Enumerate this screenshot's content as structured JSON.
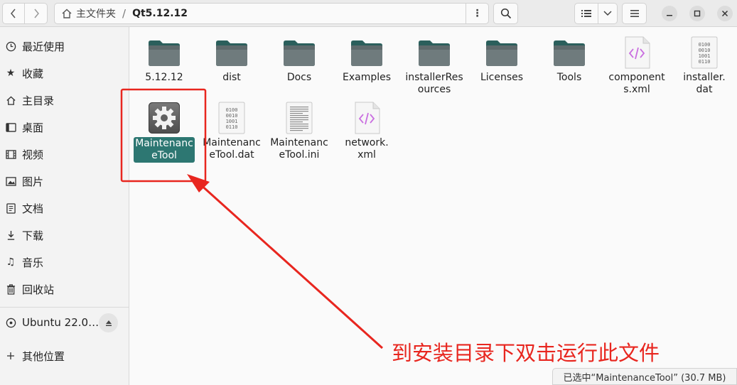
{
  "toolbar": {
    "back_icon": "chevron-left-icon",
    "forward_icon": "chevron-right-icon",
    "path": {
      "home_icon": "home-icon",
      "parent": "主文件夹",
      "separator": "/",
      "current": "Qt5.12.12",
      "menu_label": "⋮"
    },
    "search_icon": "search-icon",
    "view_icon": "list-view-icon",
    "view_dropdown_icon": "chevron-down-icon",
    "menu_icon": "hamburger-icon",
    "window_buttons": [
      "minimize-icon",
      "maximize-icon",
      "close-icon"
    ]
  },
  "sidebar": {
    "items": [
      {
        "icon": "clock-icon",
        "label": "最近使用"
      },
      {
        "icon": "star-icon",
        "label": "收藏"
      },
      {
        "icon": "home-icon",
        "label": "主目录"
      },
      {
        "icon": "desktop-icon",
        "label": "桌面"
      },
      {
        "icon": "video-icon",
        "label": "视频"
      },
      {
        "icon": "picture-icon",
        "label": "图片"
      },
      {
        "icon": "document-icon",
        "label": "文档"
      },
      {
        "icon": "download-icon",
        "label": "下载"
      },
      {
        "icon": "music-icon",
        "label": "音乐"
      },
      {
        "icon": "trash-icon",
        "label": "回收站"
      }
    ],
    "drive": {
      "icon": "disk-icon",
      "label": "Ubuntu 22.0…",
      "eject_icon": "eject-icon"
    },
    "other": {
      "icon": "plus-icon",
      "label": "其他位置"
    }
  },
  "files": [
    {
      "name_lines": [
        "5.12.12"
      ],
      "type": "folder"
    },
    {
      "name_lines": [
        "dist"
      ],
      "type": "folder"
    },
    {
      "name_lines": [
        "Docs"
      ],
      "type": "folder"
    },
    {
      "name_lines": [
        "Examples"
      ],
      "type": "folder"
    },
    {
      "name_lines": [
        "installerRes",
        "ources"
      ],
      "type": "folder"
    },
    {
      "name_lines": [
        "Licenses"
      ],
      "type": "folder"
    },
    {
      "name_lines": [
        "Tools"
      ],
      "type": "folder"
    },
    {
      "name_lines": [
        "component",
        "s.xml"
      ],
      "type": "xml"
    },
    {
      "name_lines": [
        "installer.",
        "dat"
      ],
      "type": "binary"
    },
    {
      "name_lines": [
        "Maintenanc",
        "eTool"
      ],
      "type": "executable",
      "selected": true
    },
    {
      "name_lines": [
        "Maintenanc",
        "eTool.dat"
      ],
      "type": "binary"
    },
    {
      "name_lines": [
        "Maintenanc",
        "eTool.ini"
      ],
      "type": "text"
    },
    {
      "name_lines": [
        "network.",
        "xml"
      ],
      "type": "xml"
    }
  ],
  "binary_glyph_lines": [
    "0100",
    "0010",
    "1001",
    "0110"
  ],
  "status": "已选中“MaintenanceTool” (30.7 MB)",
  "annotation": {
    "text": "到安装目录下双击运行此文件",
    "color": "#e8261f"
  },
  "colors": {
    "selection": "#2d7772",
    "folder": "#2f6f6b",
    "annotation_box": "#e8261f"
  }
}
